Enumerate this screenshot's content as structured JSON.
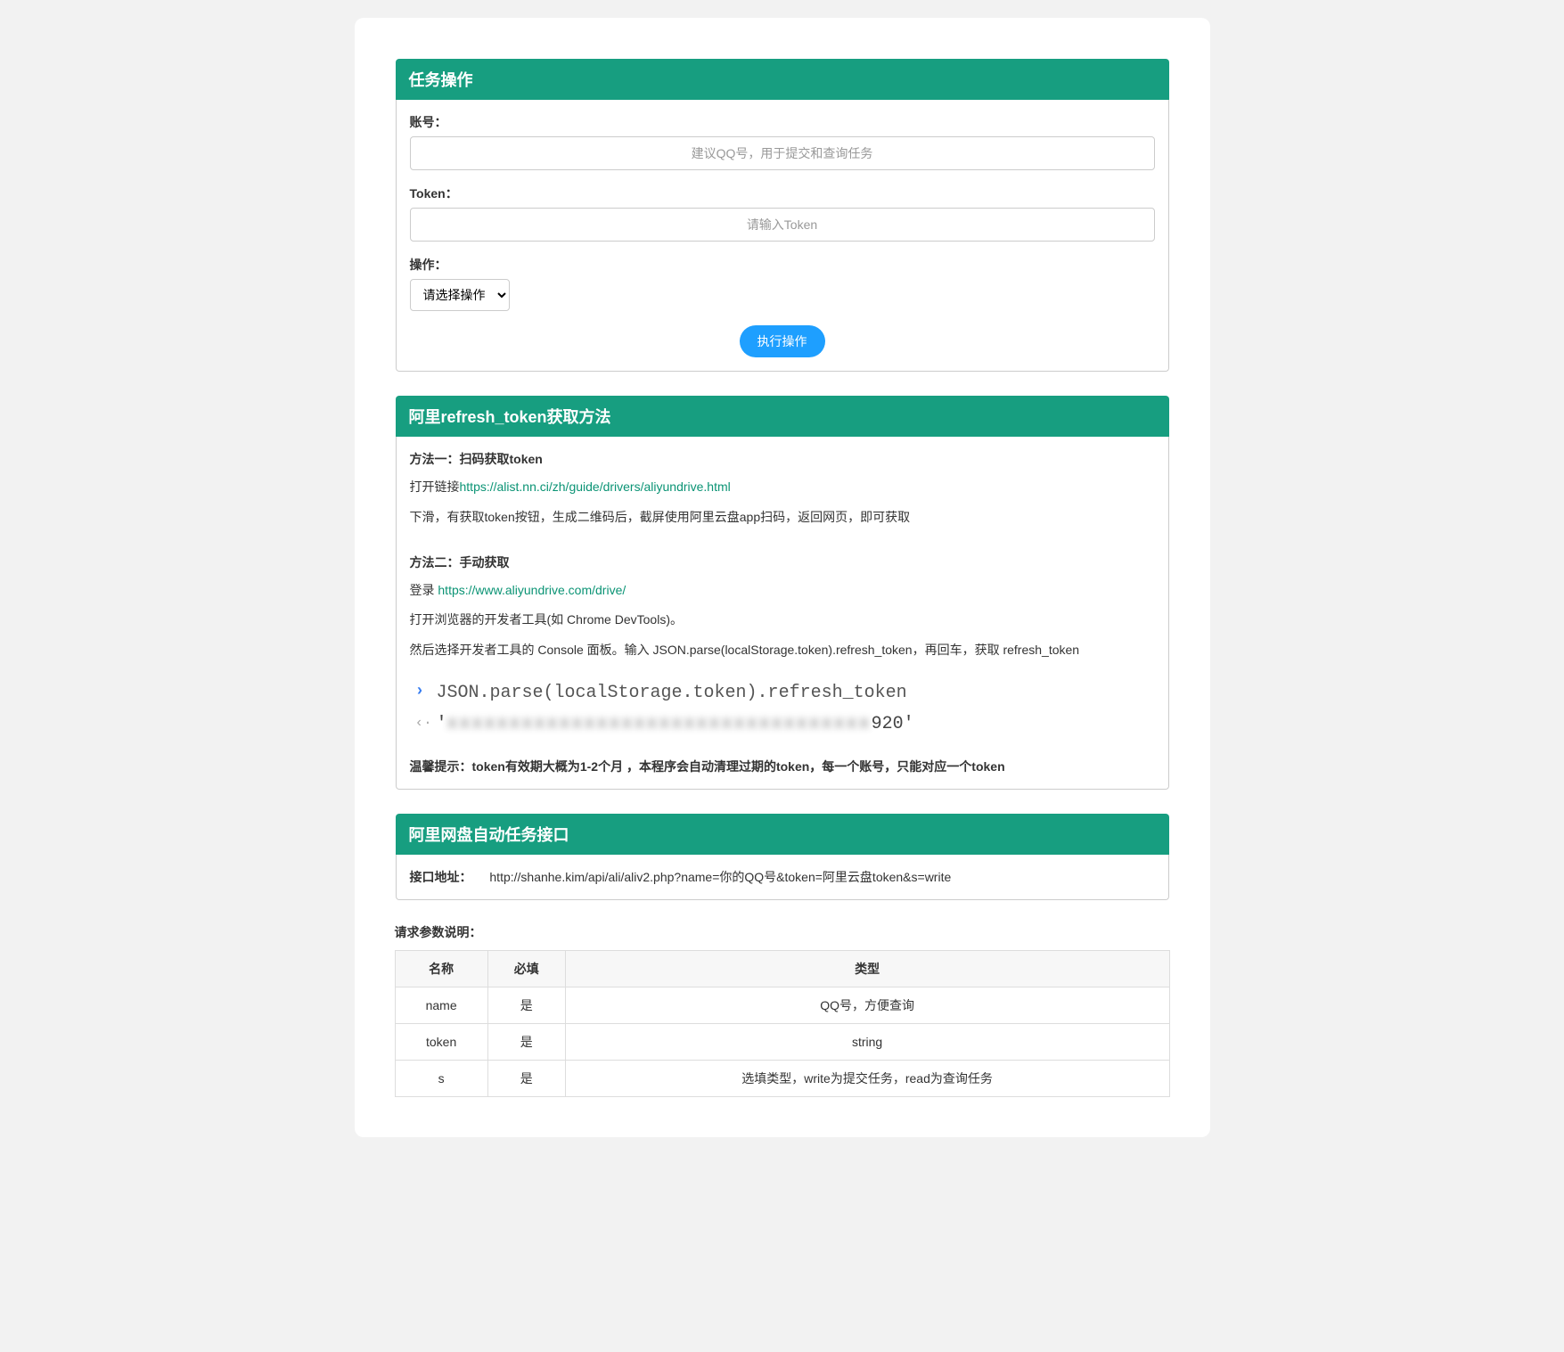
{
  "panel1": {
    "title": "任务操作",
    "account_label": "账号：",
    "account_placeholder": "建议QQ号，用于提交和查询任务",
    "token_label": "Token：",
    "token_placeholder": "请输入Token",
    "operation_label": "操作：",
    "operation_select": "请选择操作",
    "submit_label": "执行操作"
  },
  "panel2": {
    "title": "阿里refresh_token获取方法",
    "method1_title": "方法一：扫码获取token",
    "method1_line1_prefix": "打开链接",
    "method1_link1": "https://alist.nn.ci/zh/guide/drivers/aliyundrive.html",
    "method1_line2": "下滑，有获取token按钮，生成二维码后，截屏使用阿里云盘app扫码，返回网页，即可获取",
    "method2_title": "方法二：手动获取",
    "method2_login": "登录 ",
    "method2_link": "https://www.aliyundrive.com/drive/",
    "method2_line2": "打开浏览器的开发者工具(如 Chrome DevTools)。",
    "method2_line3": "然后选择开发者工具的 Console 面板。输入 JSON.parse(localStorage.token).refresh_token，再回车，获取 refresh_token",
    "console_code": "JSON.parse(localStorage.token).refresh_token",
    "console_result_visible": "920'",
    "warm_tip": "温馨提示：token有效期大概为1-2个月 ，本程序会自动清理过期的token，每一个账号，只能对应一个token"
  },
  "panel3": {
    "title": "阿里网盘自动任务接口",
    "api_label": "接口地址：",
    "api_url": "http://shanhe.kim/api/ali/aliv2.php?name=你的QQ号&token=阿里云盘token&s=write"
  },
  "params": {
    "title": "请求参数说明：",
    "headers": [
      "名称",
      "必填",
      "类型"
    ],
    "rows": [
      {
        "name": "name",
        "required": "是",
        "type": "QQ号，方便查询"
      },
      {
        "name": "token",
        "required": "是",
        "type": "string"
      },
      {
        "name": "s",
        "required": "是",
        "type": "选填类型，write为提交任务，read为查询任务"
      }
    ]
  }
}
